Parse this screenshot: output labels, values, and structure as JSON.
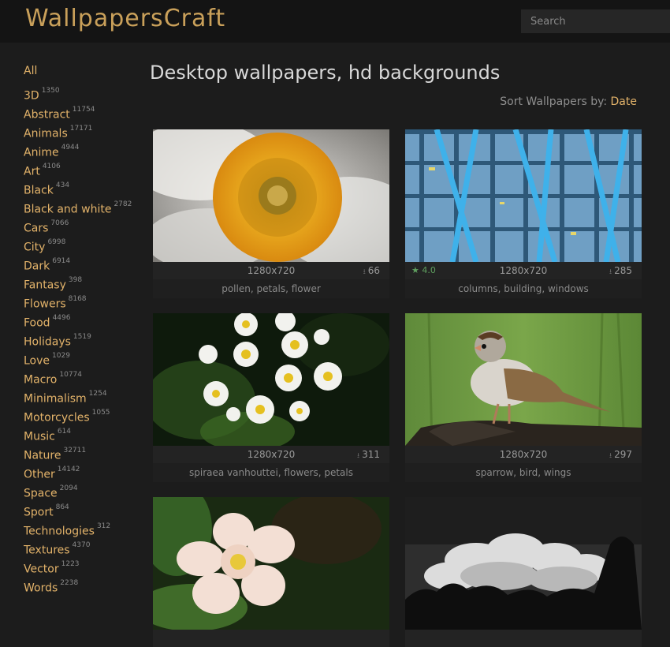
{
  "header": {
    "logo": "WallpapersCraft",
    "search_placeholder": "Search"
  },
  "sidebar": {
    "all_label": "All",
    "categories": [
      {
        "name": "3D",
        "count": "1350"
      },
      {
        "name": "Abstract",
        "count": "11754"
      },
      {
        "name": "Animals",
        "count": "17171"
      },
      {
        "name": "Anime",
        "count": "4944"
      },
      {
        "name": "Art",
        "count": "4106"
      },
      {
        "name": "Black",
        "count": "434"
      },
      {
        "name": "Black and white",
        "count": "2782"
      },
      {
        "name": "Cars",
        "count": "7066"
      },
      {
        "name": "City",
        "count": "6998"
      },
      {
        "name": "Dark",
        "count": "6914"
      },
      {
        "name": "Fantasy",
        "count": "398"
      },
      {
        "name": "Flowers",
        "count": "8168"
      },
      {
        "name": "Food",
        "count": "4496"
      },
      {
        "name": "Holidays",
        "count": "1519"
      },
      {
        "name": "Love",
        "count": "1029"
      },
      {
        "name": "Macro",
        "count": "10774"
      },
      {
        "name": "Minimalism",
        "count": "1254"
      },
      {
        "name": "Motorcycles",
        "count": "1055"
      },
      {
        "name": "Music",
        "count": "614"
      },
      {
        "name": "Nature",
        "count": "32711"
      },
      {
        "name": "Other",
        "count": "14142"
      },
      {
        "name": "Space",
        "count": "2094"
      },
      {
        "name": "Sport",
        "count": "864"
      },
      {
        "name": "Technologies",
        "count": "312"
      },
      {
        "name": "Textures",
        "count": "4370"
      },
      {
        "name": "Vector",
        "count": "1223"
      },
      {
        "name": "Words",
        "count": "2238"
      }
    ]
  },
  "main": {
    "title": "Desktop wallpapers, hd backgrounds",
    "sort_label": "Sort Wallpapers by:",
    "sort_value": "Date",
    "wallpapers": [
      {
        "resolution": "1280x720",
        "rating": "",
        "downloads": "66",
        "tags": "pollen, petals, flower"
      },
      {
        "resolution": "1280x720",
        "rating": "4.0",
        "downloads": "285",
        "tags": "columns, building, windows"
      },
      {
        "resolution": "1280x720",
        "rating": "",
        "downloads": "311",
        "tags": "spiraea vanhouttei, flowers, petals"
      },
      {
        "resolution": "1280x720",
        "rating": "",
        "downloads": "297",
        "tags": "sparrow, bird, wings"
      },
      {
        "resolution": "",
        "rating": "",
        "downloads": "",
        "tags": ""
      },
      {
        "resolution": "",
        "rating": "",
        "downloads": "",
        "tags": ""
      }
    ]
  },
  "icons": {
    "star": "star-icon",
    "download": "download-arrow-icon"
  },
  "colors": {
    "accent": "#e3b36a",
    "logo": "#c9a05a",
    "background": "#1c1c1c",
    "rating": "#5fa05f"
  }
}
